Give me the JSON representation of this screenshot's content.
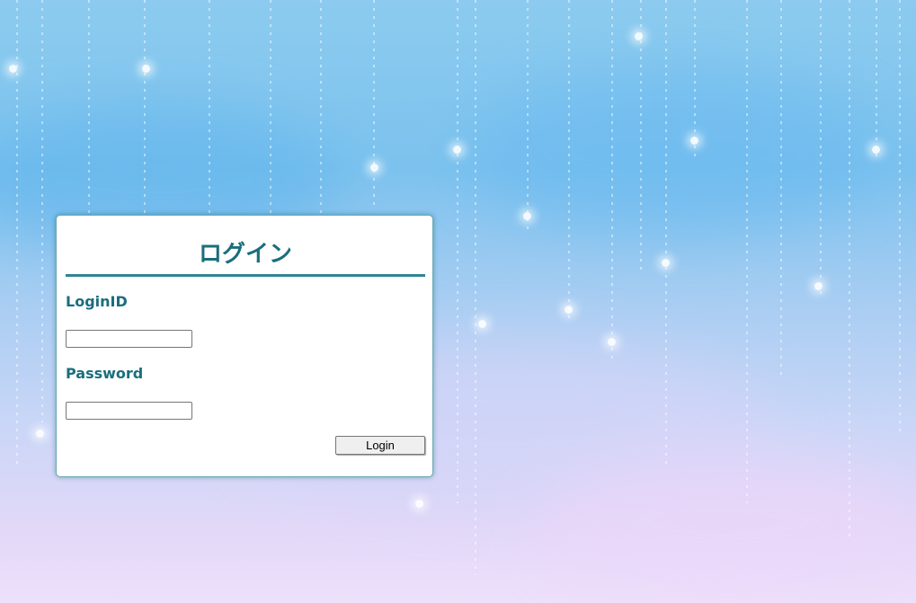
{
  "login": {
    "title": "ログイン",
    "login_id_label": "LoginID",
    "login_id_value": "",
    "password_label": "Password",
    "password_value": "",
    "submit_label": "Login"
  },
  "theme": {
    "accent": "#1a6e7c",
    "rule": "#2f8591",
    "panel_background": "#ffffff"
  }
}
